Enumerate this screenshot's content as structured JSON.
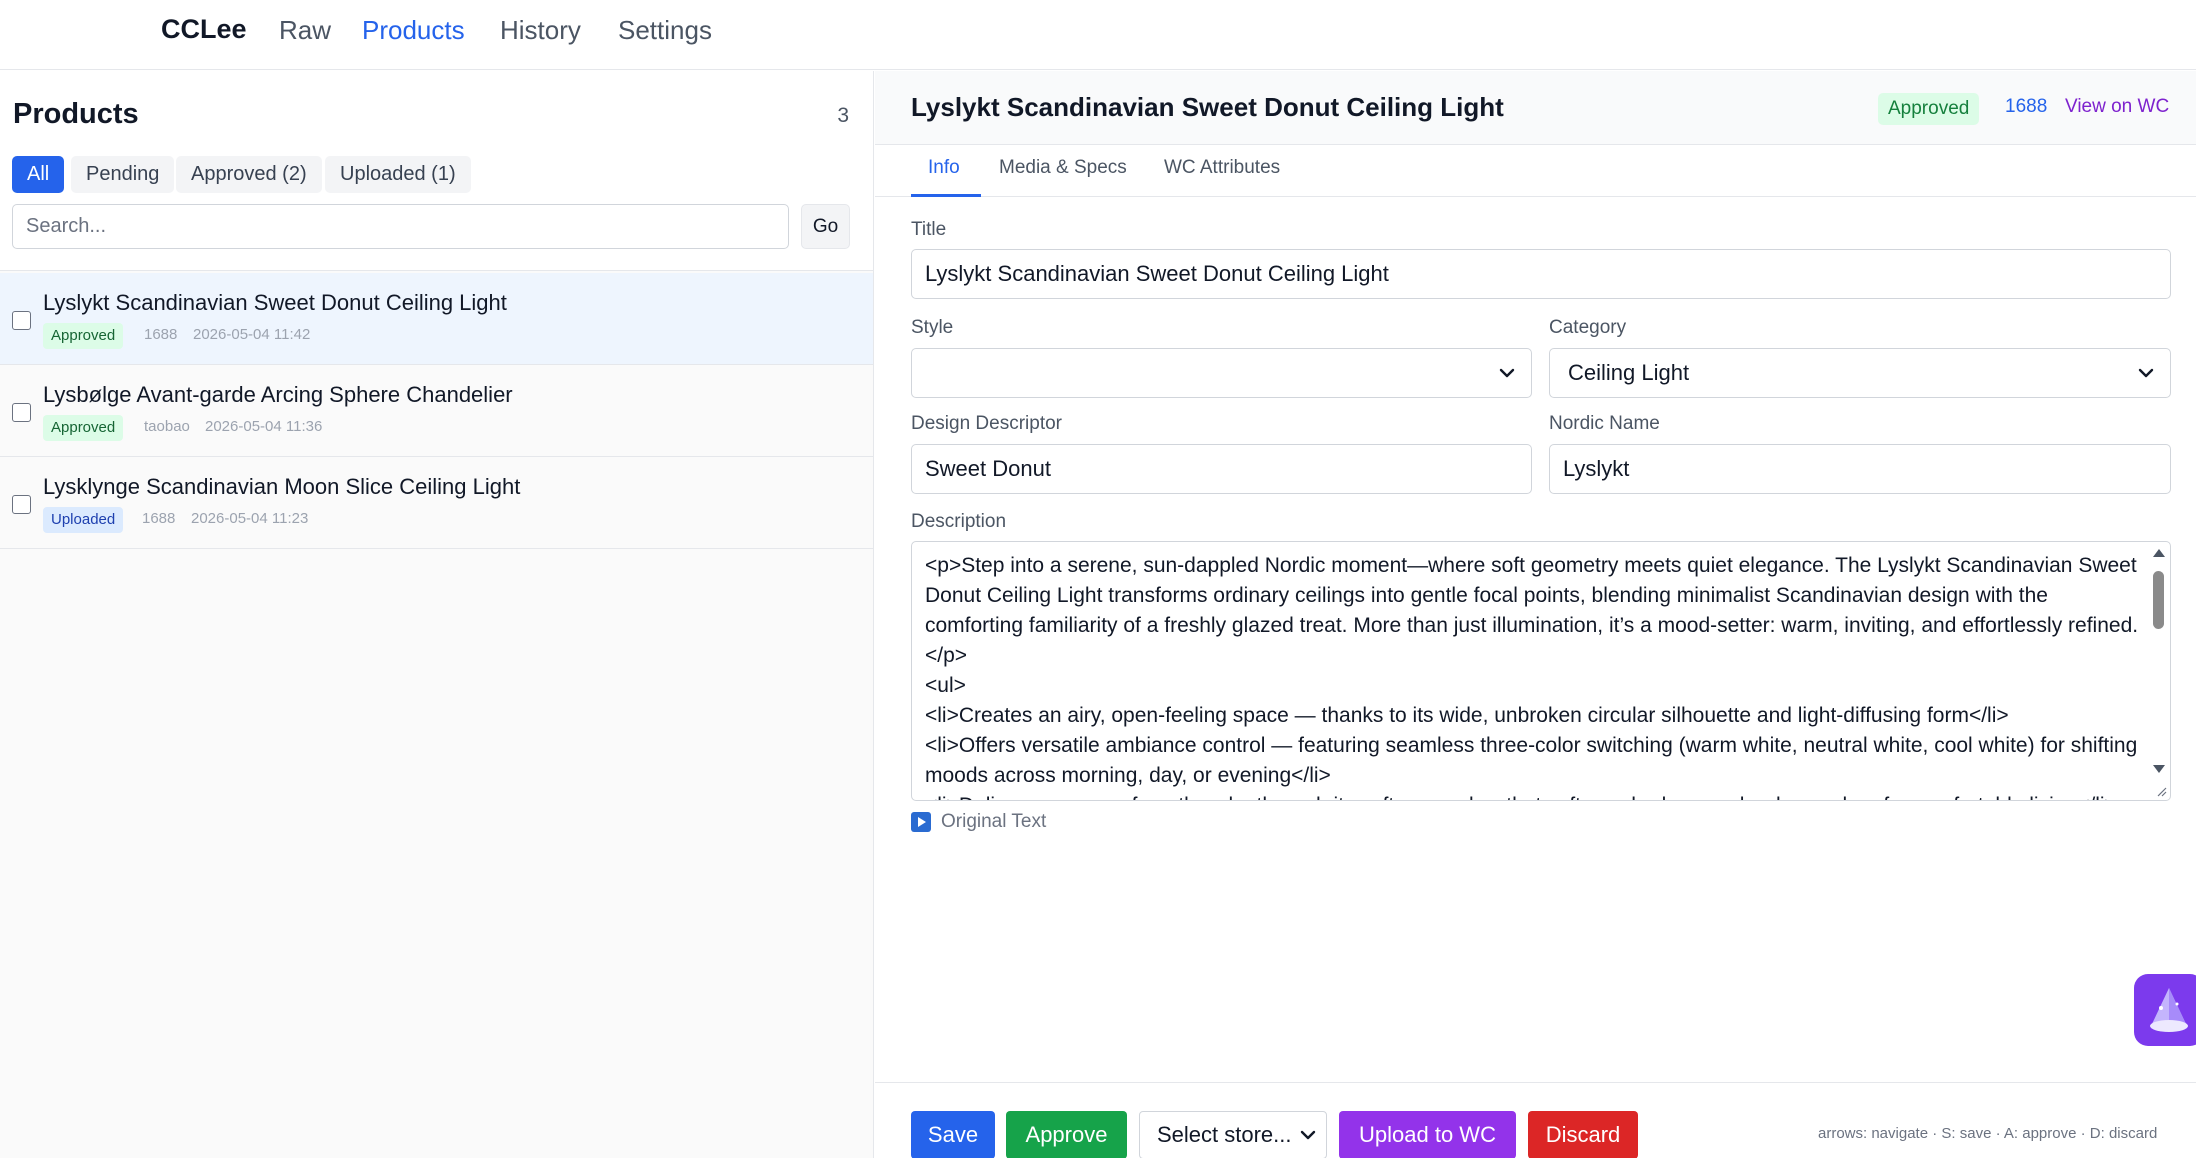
{
  "nav": {
    "brand": "CCLee",
    "links": [
      "Raw",
      "Products",
      "History",
      "Settings"
    ],
    "active": "Products"
  },
  "sidebar": {
    "title": "Products",
    "count": "3",
    "filters": [
      "All",
      "Pending",
      "Approved (2)",
      "Uploaded (1)"
    ],
    "active_filter": "All",
    "search_placeholder": "Search...",
    "go_label": "Go",
    "items": [
      {
        "title": "Lyslykt Scandinavian Sweet Donut Ceiling Light",
        "status": "Approved",
        "source": "1688",
        "date": "2026-05-04 11:42",
        "selected": true,
        "checked": false
      },
      {
        "title": "Lysbølge Avant-garde Arcing Sphere Chandelier",
        "status": "Approved",
        "source": "taobao",
        "date": "2026-05-04 11:36",
        "selected": false,
        "checked": false
      },
      {
        "title": "Lysklynge Scandinavian Moon Slice Ceiling Light",
        "status": "Uploaded",
        "source": "1688",
        "date": "2026-05-04 11:23",
        "selected": false,
        "checked": false
      }
    ]
  },
  "detail": {
    "title": "Lyslykt Scandinavian Sweet Donut Ceiling Light",
    "status": "Approved",
    "source": "1688",
    "wc_link": "View on WC",
    "tabs": [
      "Info",
      "Media & Specs",
      "WC Attributes"
    ],
    "active_tab": "Info",
    "fields": {
      "title_label": "Title",
      "title_value": "Lyslykt Scandinavian Sweet Donut Ceiling Light",
      "style_label": "Style",
      "style_value": "",
      "category_label": "Category",
      "category_value": "Ceiling Light",
      "descriptor_label": "Design Descriptor",
      "descriptor_value": "Sweet Donut",
      "nordic_label": "Nordic Name",
      "nordic_value": "Lyslykt",
      "description_label": "Description",
      "description_value": "<p>Step into a serene, sun-dappled Nordic moment—where soft geometry meets quiet elegance. The Lyslykt Scandinavian Sweet Donut Ceiling Light transforms ordinary ceilings into gentle focal points, blending minimalist Scandinavian design with the comforting familiarity of a freshly glazed treat. More than just illumination, it’s a mood-setter: warm, inviting, and effortlessly refined.</p>\n<ul>\n<li>Creates an airy, open-feeling space — thanks to its wide, unbroken circular silhouette and light-diffusing form</li>\n<li>Offers versatile ambiance control — featuring seamless three-color switching (warm white, neutral white, cool white) for shifting moods across morning, day, or evening</li>\n<li>Delivers a sense of gentle calm through its soft, even glow that softens shadows and reduces glare for comfortable living</li>",
      "original_text_label": "Original Text"
    },
    "actions": {
      "save": "Save",
      "approve": "Approve",
      "store_placeholder": "Select store...",
      "upload": "Upload to WC",
      "discard": "Discard"
    },
    "hint": "arrows: navigate · S: save · A: approve · D: discard"
  },
  "colors": {
    "accent": "#2563eb",
    "approve": "#16a34a",
    "upload": "#9333ea",
    "discard": "#dc2626",
    "approved_badge_bg": "#dcfce7",
    "uploaded_badge_bg": "#dbeafe",
    "fab": "#7c3aed"
  },
  "icons": {
    "checkbox": "checkbox-icon",
    "dropdown": "chevron-down-icon",
    "original_text": "play-triangle-icon",
    "fab": "assistant-icon"
  }
}
